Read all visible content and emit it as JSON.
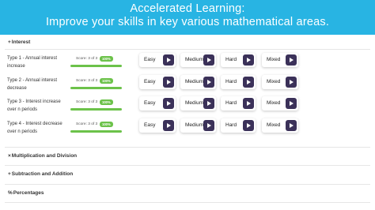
{
  "banner": {
    "line1": "Accelerated Learning:",
    "line2": "Improve your skills in key various mathematical areas."
  },
  "sections": [
    {
      "symbol": "+",
      "title": "Interest"
    },
    {
      "symbol": "×",
      "title": "Multiplication and Division"
    },
    {
      "symbol": "+",
      "title": "Subtraction and Addition"
    },
    {
      "symbol": "%",
      "title": "Percentages"
    }
  ],
  "levels": [
    "Easy",
    "Medium",
    "Hard",
    "Mixed"
  ],
  "rows": [
    {
      "label": "Type 1 - Annual interest increase",
      "score": "Score: 3 of 3",
      "badge": "100%",
      "progress": 1.0
    },
    {
      "label": "Type 2 - Annual interest decrease",
      "score": "Score: 3 of 3",
      "badge": "100%",
      "progress": 1.0
    },
    {
      "label": "Type 3 - Interest increase over n periods",
      "score": "Score: 3 of 3",
      "badge": "100%",
      "progress": 1.0
    },
    {
      "label": "Type 4 - Interest decrease over n periods",
      "score": "Score: 3 of 3",
      "badge": "100%",
      "progress": 1.0
    }
  ],
  "colors": {
    "banner": "#28b4e3",
    "play_button": "#3b3159",
    "score_green": "#6cc24a"
  },
  "icons": {
    "play": "play-icon"
  }
}
